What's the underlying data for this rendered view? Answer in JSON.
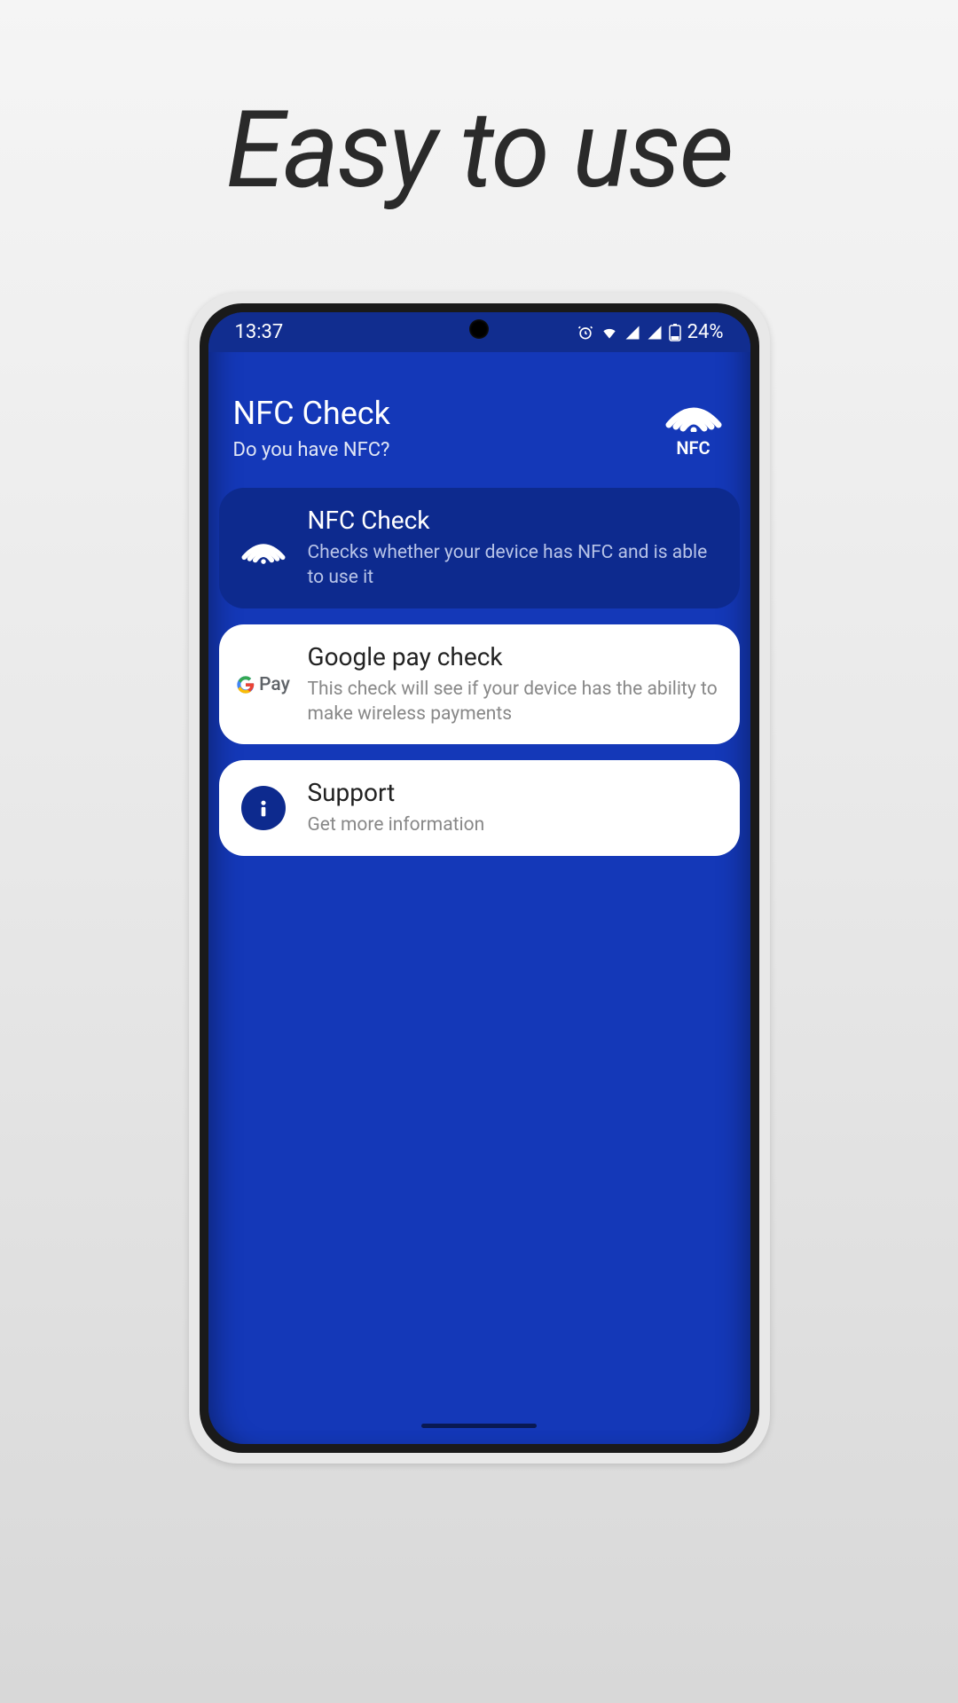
{
  "promo": {
    "headline": "Easy to use"
  },
  "statusbar": {
    "time": "13:37",
    "battery_text": "24%"
  },
  "header": {
    "title": "NFC Check",
    "subtitle": "Do you have NFC?",
    "nfc_label": "NFC"
  },
  "cards": [
    {
      "title": "NFC Check",
      "subtitle": "Checks whether your device has NFC and is able to use it"
    },
    {
      "title": "Google pay check",
      "subtitle": "This check will see if your device has the ability to make wireless payments",
      "icon_label": "Pay"
    },
    {
      "title": "Support",
      "subtitle": "Get more information"
    }
  ]
}
